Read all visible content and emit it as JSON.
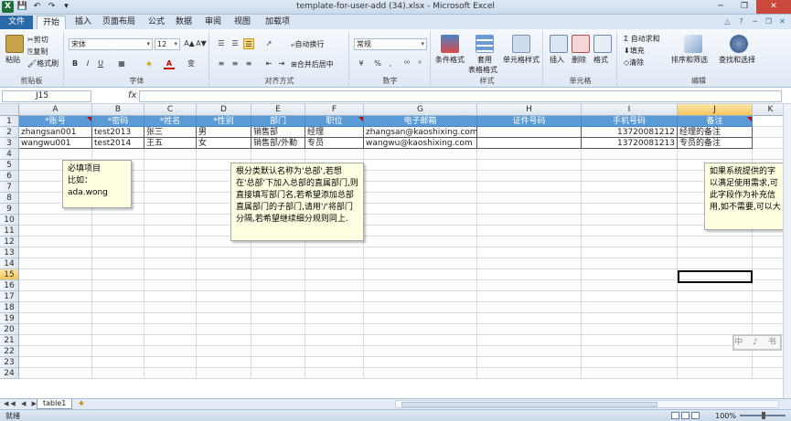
{
  "window": {
    "title": "template-for-user-add (34).xlsx - Microsoft Excel",
    "min": "─",
    "max": "❐",
    "close": "✕"
  },
  "qat": {
    "save": "💾",
    "undo": "↶",
    "redo": "↷",
    "more": "▾"
  },
  "tabs": {
    "file": "文件",
    "home": "开始",
    "insert": "插入",
    "layout": "页面布局",
    "formulas": "公式",
    "data": "数据",
    "review": "审阅",
    "view": "视图",
    "addins": "加载项"
  },
  "ribbon": {
    "clipboard": {
      "label": "剪贴板",
      "paste": "粘贴",
      "cut": "剪切",
      "copy": "复制",
      "format_painter": "格式刷"
    },
    "font": {
      "label": "字体",
      "name": "宋体",
      "size": "12",
      "bold": "B",
      "italic": "I",
      "underline": "U",
      "grow": "A▲",
      "shrink": "A▼",
      "font_color": "A",
      "phonetic": "变"
    },
    "alignment": {
      "label": "对齐方式",
      "wrap": "自动换行",
      "merge": "合并后居中"
    },
    "number": {
      "label": "数字",
      "format": "常规",
      "percent": "%",
      "comma": ","
    },
    "styles": {
      "label": "样式",
      "conditional": "条件格式",
      "table": "套用",
      "table2": "表格格式",
      "cell_styles": "单元格样式"
    },
    "cells": {
      "label": "单元格",
      "insert": "插入",
      "delete": "删除",
      "format": "格式"
    },
    "editing": {
      "label": "编辑",
      "autosum": "Σ 自动求和",
      "fill": "填充",
      "clear": "清除",
      "sort": "排序和筛选",
      "find": "查找和选择"
    }
  },
  "formula_bar": {
    "name_box": "J15",
    "fx": "fx",
    "value": ""
  },
  "columns": [
    "A",
    "B",
    "C",
    "D",
    "E",
    "F",
    "G",
    "H",
    "I",
    "J",
    "K"
  ],
  "rows": [
    "1",
    "2",
    "3",
    "4",
    "5",
    "6",
    "7",
    "8",
    "9",
    "10",
    "11",
    "12",
    "13",
    "14",
    "15",
    "16",
    "17",
    "18",
    "19",
    "20",
    "21",
    "22",
    "23",
    "24"
  ],
  "table": {
    "headers": [
      "*账号",
      "*密码",
      "*姓名",
      "*性别",
      "部门",
      "职位",
      "电子邮箱",
      "证件号码",
      "手机号码",
      "备注"
    ],
    "rows": [
      [
        "zhangsan001",
        "test2013",
        "张三",
        "男",
        "销售部",
        "经理",
        "zhangsan@kaoshixing.com",
        "",
        "13720081212",
        "经理的备注"
      ],
      [
        "wangwu001",
        "test2014",
        "王五",
        "女",
        "销售部/外勤",
        "专员",
        "wangwu@kaoshixing.com",
        "",
        "13720081213",
        "专员的备注"
      ]
    ]
  },
  "notes": {
    "a": "必填项目\n比如：\nada.wong",
    "e": "根分类默认名称为'总部',若想在'总部'下加入总部的直属部门,则直接填写部门名,若希望添加总部直属部门的子部门,请用'/'将部门分隔,若希望继续细分规则同上.",
    "j": "如果系统提供的字\n以满足使用需求,可\n此字段作为补充信\n用,如不需要,可以大"
  },
  "watermark": "中 ♪ 书",
  "sheet_tabs": {
    "nav": "◀◀ ◀ ▶ ▶▶",
    "sheet1": "table1"
  },
  "status": {
    "ready": "就绪",
    "zoom": "100%"
  }
}
